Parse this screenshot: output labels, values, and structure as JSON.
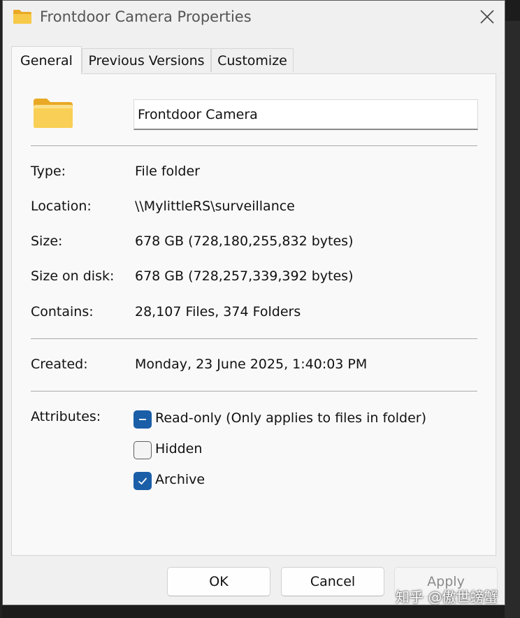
{
  "window": {
    "title": "Frontdoor Camera Properties"
  },
  "tabs": [
    {
      "label": "General",
      "active": true
    },
    {
      "label": "Previous Versions",
      "active": false
    },
    {
      "label": "Customize",
      "active": false
    }
  ],
  "general": {
    "folder_name": "Frontdoor Camera",
    "type_label": "Type:",
    "type_value": "File folder",
    "location_label": "Location:",
    "location_value": "\\\\MylittleRS\\surveillance",
    "size_label": "Size:",
    "size_value": "678 GB (728,180,255,832 bytes)",
    "size_on_disk_label": "Size on disk:",
    "size_on_disk_value": "678 GB (728,257,339,392 bytes)",
    "contains_label": "Contains:",
    "contains_value": "28,107 Files, 374 Folders",
    "created_label": "Created:",
    "created_value": "Monday, 23 June 2025, 1:40:03 PM",
    "attributes_label": "Attributes:",
    "attributes": {
      "readonly": {
        "label": "Read-only (Only applies to files in folder)",
        "state": "indeterminate"
      },
      "hidden": {
        "label": "Hidden",
        "state": "unchecked"
      },
      "archive": {
        "label": "Archive",
        "state": "checked"
      }
    }
  },
  "buttons": {
    "ok": "OK",
    "cancel": "Cancel",
    "apply": "Apply"
  },
  "watermark": "知乎 @傲世螃蟹",
  "colors": {
    "accent": "#1a5ea8",
    "folder": "#f7c948",
    "folder_back": "#e9a825"
  },
  "icons": {
    "title": "folder-icon",
    "close": "close-icon",
    "folder": "folder-icon"
  }
}
